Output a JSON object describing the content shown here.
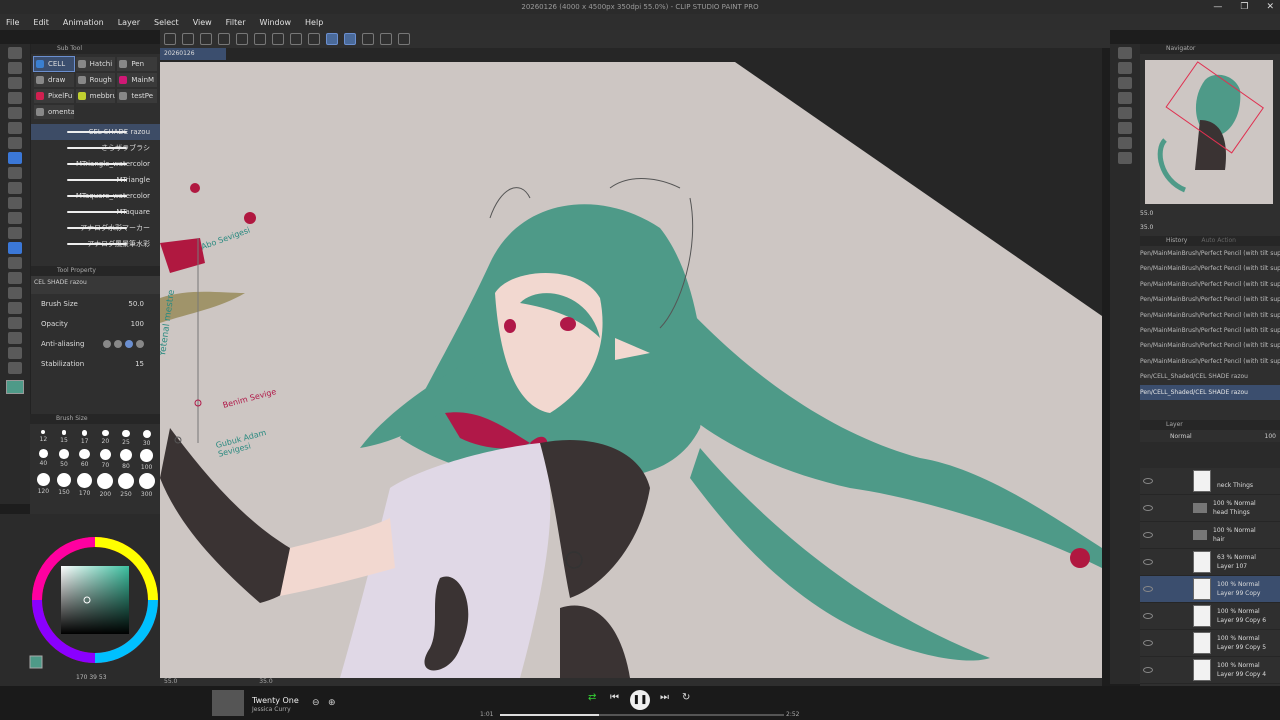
{
  "titlebar": {
    "title": "20260126 (4000 x 4500px 350dpi 55.0%) - CLIP STUDIO PAINT PRO",
    "min": "—",
    "max": "❐",
    "close": "✕"
  },
  "menu": [
    "File",
    "Edit",
    "Animation",
    "Layer",
    "Select",
    "View",
    "Filter",
    "Window",
    "Help"
  ],
  "doc_tab": "20260126",
  "subtool": {
    "title": "Sub Tool",
    "tabs": [
      {
        "label": "CELL",
        "color": "#3a7fd0",
        "selected": true
      },
      {
        "label": "Hatchi",
        "color": "#888888"
      },
      {
        "label": "Pen",
        "color": "#888888"
      },
      {
        "label": "draw",
        "color": "#888888"
      },
      {
        "label": "Rough",
        "color": "#888888"
      },
      {
        "label": "MainM",
        "color": "#d01876"
      },
      {
        "label": "PixelFu",
        "color": "#d02050"
      },
      {
        "label": "mebbru",
        "color": "#c0d030"
      },
      {
        "label": "testPe",
        "color": "#888888"
      },
      {
        "label": "omenta",
        "color": "#888888"
      }
    ],
    "brushes": [
      "CEL SHADE razou",
      "さらザラブラシ",
      "MTriangle_watercolor",
      "MTriangle",
      "MTaquare_watercolor",
      "MTaquare",
      "アナログ水彩マーカー",
      "アナログ風景筆水彩"
    ]
  },
  "tool_property": {
    "title": "Tool Property",
    "name": "CEL SHADE razou",
    "rows": [
      {
        "label": "Brush Size",
        "value": "50.0"
      },
      {
        "label": "Opacity",
        "value": "100"
      },
      {
        "label": "Anti-aliasing",
        "value": ""
      },
      {
        "label": "Stabilization",
        "value": "15"
      }
    ]
  },
  "brush_size": {
    "title": "Brush Size",
    "sizes": [
      "12",
      "15",
      "17",
      "20",
      "25",
      "30",
      "40",
      "50",
      "60",
      "70",
      "80",
      "100",
      "120",
      "150",
      "170",
      "200",
      "250",
      "300"
    ]
  },
  "color_readout": "170 39 53",
  "canvas_zoom": "55.0",
  "canvas_angle": "35.0",
  "annotations": {
    "a1": "Abo Sevigesi",
    "a2": "Yetenal mestre",
    "a3": "Benim Sevige",
    "a4": "Gubuk Adam Sevigesi"
  },
  "navigator": {
    "title": "Navigator",
    "zoom": "55.0",
    "angle": "35.0"
  },
  "history": {
    "title": "History",
    "tab2": "Auto Action",
    "rows": [
      "Pen/MainMainBrush/Perfect Pencil (with tilt support)",
      "Pen/MainMainBrush/Perfect Pencil (with tilt support)",
      "Pen/MainMainBrush/Perfect Pencil (with tilt support)",
      "Pen/MainMainBrush/Perfect Pencil (with tilt support)",
      "Pen/MainMainBrush/Perfect Pencil (with tilt support)",
      "Pen/MainMainBrush/Perfect Pencil (with tilt support)",
      "Pen/MainMainBrush/Perfect Pencil (with tilt support)",
      "Pen/MainMainBrush/Perfect Pencil (with tilt support)",
      "Pen/CELL_Shaded/CEL SHADE razou",
      "Pen/CELL_Shaded/CEL SHADE razou"
    ]
  },
  "layers": {
    "title": "Layer",
    "blend": "Normal",
    "opacity": "100",
    "rows": [
      {
        "l1": "",
        "l2": "neck Things",
        "kind": "layer"
      },
      {
        "l1": "100 % Normal",
        "l2": "head Things",
        "kind": "folder"
      },
      {
        "l1": "100 % Normal",
        "l2": "hair",
        "kind": "folder"
      },
      {
        "l1": "63 % Normal",
        "l2": "Layer 107",
        "kind": "layer"
      },
      {
        "l1": "100 % Normal",
        "l2": "Layer 99 Copy",
        "kind": "layer",
        "sel": true
      },
      {
        "l1": "100 % Normal",
        "l2": "Layer 99 Copy 6",
        "kind": "layer"
      },
      {
        "l1": "100 % Normal",
        "l2": "Layer 99 Copy 5",
        "kind": "layer"
      },
      {
        "l1": "100 % Normal",
        "l2": "Layer 99 Copy 4",
        "kind": "layer"
      },
      {
        "l1": "100 % Normal",
        "l2": "",
        "kind": "layer"
      }
    ]
  },
  "player": {
    "track": "Twenty One",
    "artist": "Jessica Curry",
    "elapsed": "1:01",
    "total": "2:52",
    "progress": 0.35
  },
  "colors": {
    "hair": "#4e9a88",
    "canvas_bg": "#cdc6c3",
    "accent": "#3b78d8",
    "ribbon": "#b01848"
  }
}
